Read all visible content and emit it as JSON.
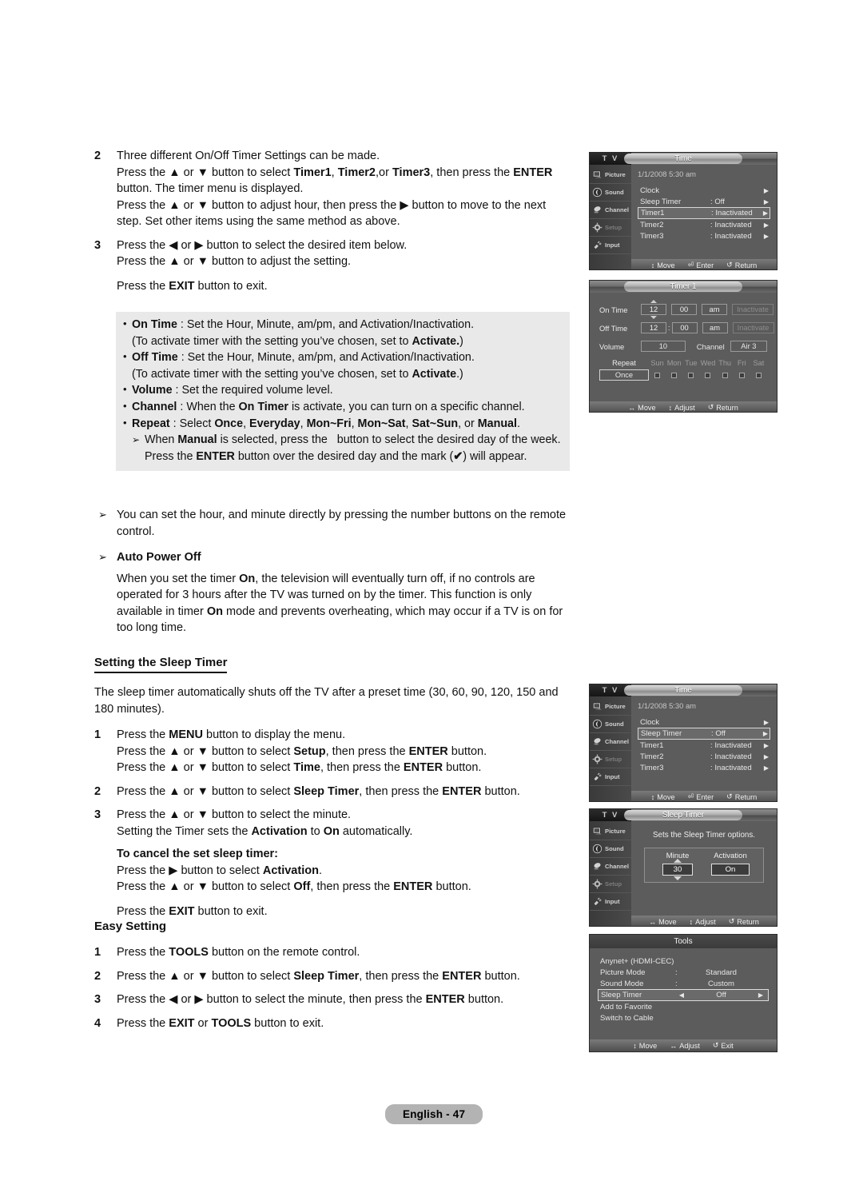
{
  "document": {
    "footer_badge": "English - 47"
  },
  "steps": {
    "s2": {
      "num": "2",
      "lines": [
        "Three different On/Off Timer Settings can be made.",
        "Press the ▲ or ▼ button to select Timer1, Timer2,or Timer3, then press the ENTER button. The timer menu is displayed.",
        "Press the ▲ or ▼ button to adjust hour, then press the ▶ button to move to the next step. Set other items using the same method as above."
      ]
    },
    "s3": {
      "num": "3",
      "lines": [
        "Press the ◀ or ▶ button to select the desired item below.",
        "Press the ▲ or ▼ button to adjust the setting.",
        "Press the EXIT button to exit."
      ]
    }
  },
  "graybox": {
    "items": [
      {
        "term": "On Time",
        "rest": " : Set the Hour, Minute, am/pm, and Activation/Inactivation.",
        "cont": "(To activate timer with the setting you’ve chosen, set to Activate.)"
      },
      {
        "term": "Off Time",
        "rest": " : Set the Hour, Minute, am/pm, and Activation/Inactivation.",
        "cont": "(To activate timer with the setting you’ve chosen, set to Activate.)"
      },
      {
        "term": "Volume",
        "rest": " : Set the required volume level."
      },
      {
        "term": "Channel",
        "rest": " : When the On Timer is activate, you can turn on a specific channel."
      },
      {
        "term": "Repeat",
        "rest": " : Select Once, Everyday, Mon~Fri, Mon~Sat, Sat~Sun, or Manual."
      }
    ],
    "note": "When Manual is selected, press the   button to select the desired day of the week. Press the ENTER button over the desired day and the mark (✔) will appear."
  },
  "notes": {
    "number_buttons": "You can set the hour, and minute directly by pressing the number buttons on the remote control.",
    "auto_power_off_heading": "Auto Power Off",
    "auto_power_off_body": "When you set the timer On, the television will eventually turn off, if no controls are operated for 3 hours after the TV was turned on by the timer. This function is only available in timer On mode and prevents overheating, which may occur if a TV is on for too long time."
  },
  "sleep_section": {
    "heading": "Setting the Sleep Timer",
    "intro": "The sleep timer automatically shuts off the TV after a preset time (30, 60, 90, 120, 150 and 180 minutes).",
    "steps": [
      {
        "num": "1",
        "lines": [
          "Press the MENU button to display the menu.",
          "Press the ▲ or ▼ button to select Setup, then press the ENTER button.",
          "Press the ▲ or ▼ button to select Time, then press the ENTER button."
        ]
      },
      {
        "num": "2",
        "lines": [
          "Press the ▲ or ▼ button to select Sleep Timer, then press the ENTER button."
        ]
      },
      {
        "num": "3",
        "lines": [
          "Press the ▲ or ▼ button to select the minute.",
          "Setting the Timer sets the Activation to On automatically."
        ]
      }
    ],
    "cancel_heading": "To cancel the set sleep timer:",
    "cancel_lines": [
      "Press the ▶ button to select Activation.",
      "Press the ▲ or ▼ button to select Off, then press the ENTER button."
    ],
    "exit_line": "Press the EXIT button to exit."
  },
  "easy_setting": {
    "heading": "Easy Setting",
    "steps": [
      {
        "num": "1",
        "text": "Press the TOOLS button on the remote control."
      },
      {
        "num": "2",
        "text": "Press the ▲ or ▼ button to select Sleep Timer, then press the ENTER button."
      },
      {
        "num": "3",
        "text": "Press the ◀ or ▶ button to select the minute, then press the ENTER button."
      },
      {
        "num": "4",
        "text": "Press the EXIT or TOOLS button to exit."
      }
    ]
  },
  "osd_common": {
    "tv_label": "T V",
    "sidebar": [
      {
        "label": "Picture",
        "icon": "picture-icon",
        "dim": false
      },
      {
        "label": "Sound",
        "icon": "sound-icon",
        "dim": false
      },
      {
        "label": "Channel",
        "icon": "channel-icon",
        "dim": false
      },
      {
        "label": "Setup",
        "icon": "gear-icon",
        "dim": true
      },
      {
        "label": "Input",
        "icon": "plug-icon",
        "dim": false
      }
    ],
    "arrow_right": "▶",
    "arrow_left": "◀",
    "updown_glyph": "↕",
    "leftright_glyph": "↔",
    "return_glyph": "↺",
    "enter_glyph": "⏎"
  },
  "osd_time_1": {
    "title": "Time",
    "clock": "1/1/2008 5:30 am",
    "rows": [
      {
        "label": "Clock",
        "value": "",
        "selected": false
      },
      {
        "label": "Sleep Timer",
        "value": ": Off",
        "selected": false
      },
      {
        "label": "Timer1",
        "value": ": Inactivated",
        "selected": true
      },
      {
        "label": "Timer2",
        "value": ": Inactivated",
        "selected": false
      },
      {
        "label": "Timer3",
        "value": ": Inactivated",
        "selected": false
      }
    ],
    "hints": [
      "Move",
      "Enter",
      "Return"
    ]
  },
  "osd_timer1": {
    "title": "Timer 1",
    "on_time": {
      "label": "On Time",
      "hour": "12",
      "minute": "00",
      "ampm": "am",
      "activation": "Inactivate"
    },
    "off_time": {
      "label": "Off Time",
      "hour": "12",
      "minute": "00",
      "ampm": "am",
      "activation": "Inactivate"
    },
    "volume_label": "Volume",
    "volume_value": "10",
    "channel_label": "Channel",
    "channel_value": "Air 3",
    "repeat_label": "Repeat",
    "repeat_value": "Once",
    "days": [
      "Sun",
      "Mon",
      "Tue",
      "Wed",
      "Thu",
      "Fri",
      "Sat"
    ],
    "hints": [
      "Move",
      "Adjust",
      "Return"
    ]
  },
  "osd_time_2": {
    "title": "Time",
    "clock": "1/1/2008 5:30 am",
    "rows": [
      {
        "label": "Clock",
        "value": "",
        "selected": false
      },
      {
        "label": "Sleep Timer",
        "value": ": Off",
        "selected": true
      },
      {
        "label": "Timer1",
        "value": ": Inactivated",
        "selected": false
      },
      {
        "label": "Timer2",
        "value": ": Inactivated",
        "selected": false
      },
      {
        "label": "Timer3",
        "value": ": Inactivated",
        "selected": false
      }
    ],
    "hints": [
      "Move",
      "Enter",
      "Return"
    ]
  },
  "osd_sleep": {
    "title": "Sleep Timer",
    "description": "Sets the Sleep Timer options.",
    "minute_header": "Minute",
    "activation_header": "Activation",
    "minute_value": "30",
    "activation_value": "On",
    "hints": [
      "Move",
      "Adjust",
      "Return"
    ]
  },
  "osd_tools": {
    "title": "Tools",
    "rows": [
      {
        "label": "Anynet+ (HDMI-CEC)",
        "colon": "",
        "value": "",
        "selected": false,
        "arrows": false
      },
      {
        "label": "Picture Mode",
        "colon": ":",
        "value": "Standard",
        "selected": false,
        "arrows": false
      },
      {
        "label": "Sound Mode",
        "colon": ":",
        "value": "Custom",
        "selected": false,
        "arrows": false
      },
      {
        "label": "Sleep Timer",
        "colon": "",
        "value": "Off",
        "selected": true,
        "arrows": true
      },
      {
        "label": "Add to Favorite",
        "colon": "",
        "value": "",
        "selected": false,
        "arrows": false
      },
      {
        "label": "Switch to Cable",
        "colon": "",
        "value": "",
        "selected": false,
        "arrows": false
      }
    ],
    "hints": [
      "Move",
      "Adjust",
      "Exit"
    ]
  }
}
